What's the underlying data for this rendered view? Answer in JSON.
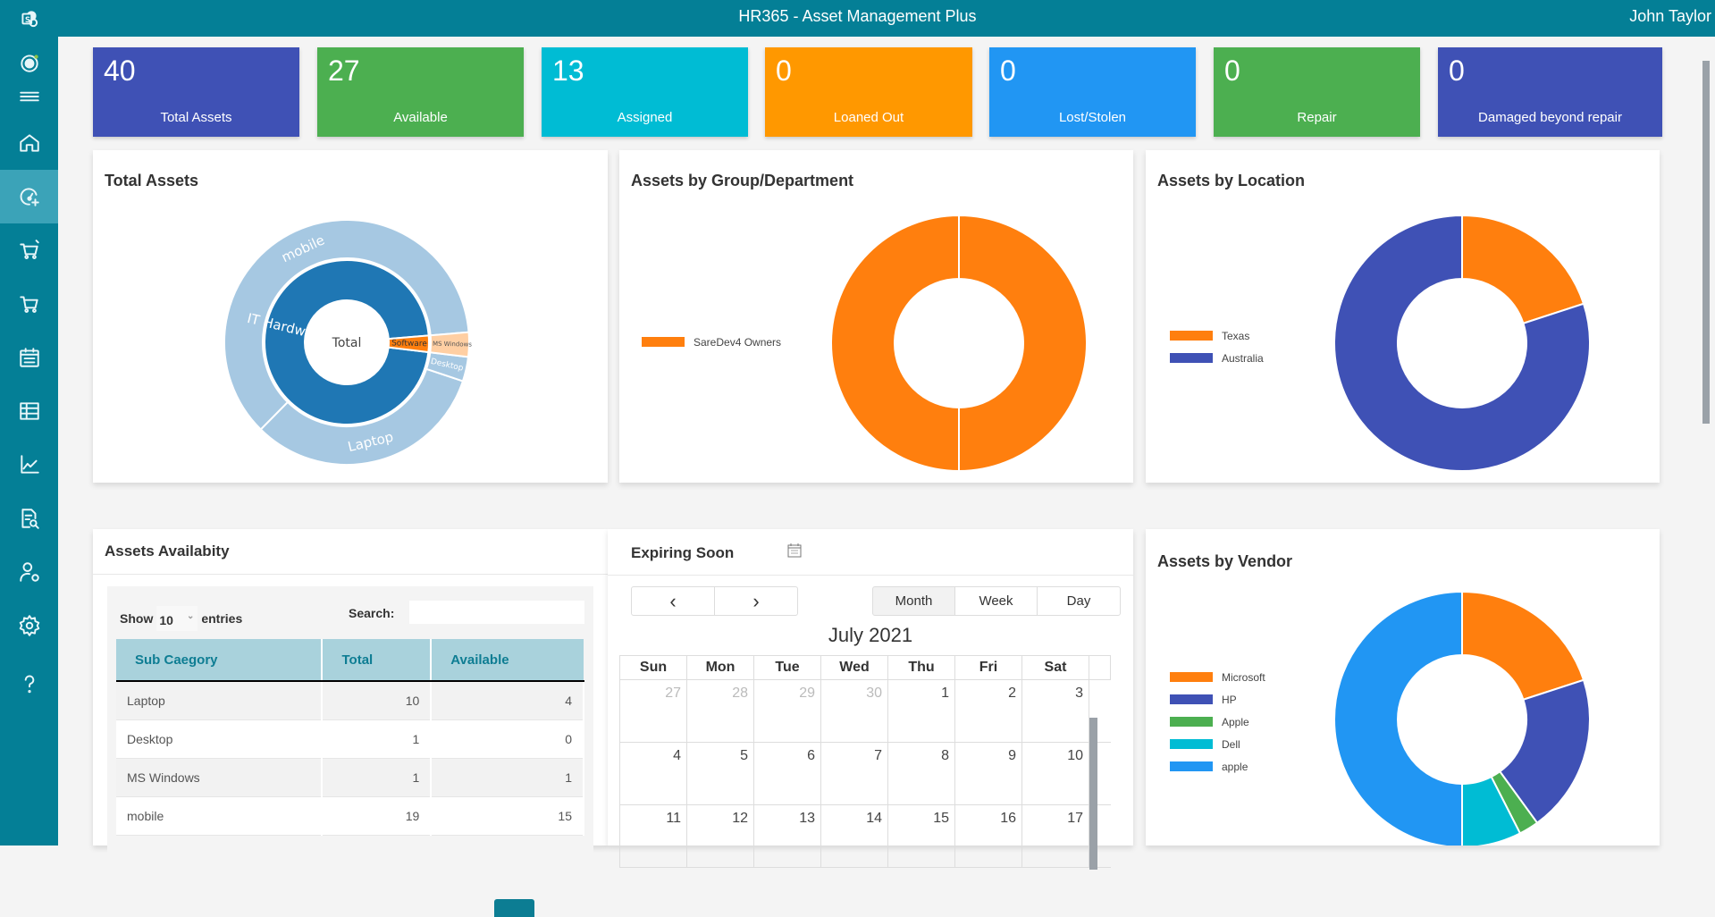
{
  "header": {
    "title": "HR365 - Asset Management Plus",
    "user": "John Taylor"
  },
  "sidebar": {
    "items": [
      {
        "icon": "sharepoint-icon"
      },
      {
        "icon": "team-icon"
      },
      {
        "icon": "hamburger-menu-icon"
      },
      {
        "icon": "home-icon"
      },
      {
        "icon": "dashboard-add-icon",
        "active": true
      },
      {
        "icon": "cart-add-icon"
      },
      {
        "icon": "cart-icon"
      },
      {
        "icon": "calendar-icon"
      },
      {
        "icon": "table-icon"
      },
      {
        "icon": "line-chart-icon"
      },
      {
        "icon": "report-search-icon"
      },
      {
        "icon": "user-settings-icon"
      },
      {
        "icon": "settings-icon"
      },
      {
        "icon": "help-icon"
      }
    ]
  },
  "stats": [
    {
      "value": "40",
      "label": "Total Assets",
      "color": "#3f51b5"
    },
    {
      "value": "27",
      "label": "Available",
      "color": "#4caf50"
    },
    {
      "value": "13",
      "label": "Assigned",
      "color": "#00bcd4"
    },
    {
      "value": "0",
      "label": "Loaned Out",
      "color": "#ff9800"
    },
    {
      "value": "0",
      "label": "Lost/Stolen",
      "color": "#2196f3"
    },
    {
      "value": "0",
      "label": "Repair",
      "color": "#4caf50"
    },
    {
      "value": "0",
      "label": "Damaged beyond repair",
      "color": "#3f51b5"
    }
  ],
  "chart_data": [
    {
      "type": "sunburst",
      "title": "Total Assets",
      "center_label": "Total",
      "inner": [
        {
          "name": "IT Hardware",
          "value": 30,
          "color": "#1f77b4"
        },
        {
          "name": "Software",
          "value": 1,
          "color": "#ff7f0e"
        }
      ],
      "outer": [
        {
          "name": "mobile",
          "parent": "IT Hardware",
          "value": 19,
          "color": "#a6c8e2"
        },
        {
          "name": "Laptop",
          "parent": "IT Hardware",
          "value": 10,
          "color": "#a6c8e2"
        },
        {
          "name": "Desktop",
          "parent": "IT Hardware",
          "value": 1,
          "color": "#a6c8e2"
        },
        {
          "name": "MS Windows",
          "parent": "Software",
          "value": 1,
          "color": "#ffcfa3"
        }
      ]
    },
    {
      "type": "pie",
      "title": "Assets by Group/Department",
      "legend": "left",
      "slices": [
        {
          "name": "SareDev4 Owners",
          "value": 40,
          "color": "#ff7f0e"
        }
      ]
    },
    {
      "type": "pie",
      "title": "Assets by Location",
      "legend": "left",
      "slices": [
        {
          "name": "Texas",
          "value": 8,
          "color": "#ff7f0e"
        },
        {
          "name": "Australia",
          "value": 32,
          "color": "#3f51b5"
        }
      ]
    },
    {
      "type": "pie",
      "title": "Assets by Vendor",
      "legend": "left",
      "slices": [
        {
          "name": "Microsoft",
          "value": 8,
          "color": "#ff7f0e"
        },
        {
          "name": "HP",
          "value": 8,
          "color": "#3f51b5"
        },
        {
          "name": "Apple",
          "value": 1,
          "color": "#4caf50"
        },
        {
          "name": "Dell",
          "value": 3,
          "color": "#00bcd4"
        },
        {
          "name": "apple",
          "value": 20,
          "color": "#2196f3"
        }
      ]
    }
  ],
  "availability": {
    "title": "Assets Availabity",
    "show_label": "Show",
    "entries_value": "10",
    "entries_label": "entries",
    "search_label": "Search:",
    "search_value": "",
    "columns": [
      "Sub Caegory",
      "Total",
      "Available"
    ],
    "rows": [
      [
        "Laptop",
        "10",
        "4"
      ],
      [
        "Desktop",
        "1",
        "0"
      ],
      [
        "MS Windows",
        "1",
        "1"
      ],
      [
        "mobile",
        "19",
        "15"
      ]
    ]
  },
  "calendar": {
    "title": "Expiring Soon",
    "prev": "‹",
    "next": "›",
    "views": [
      "Month",
      "Week",
      "Day"
    ],
    "active_view": "Month",
    "month_title": "July 2021",
    "weekdays": [
      "Sun",
      "Mon",
      "Tue",
      "Wed",
      "Thu",
      "Fri",
      "Sat"
    ],
    "weeks": [
      [
        {
          "d": "27",
          "m": true
        },
        {
          "d": "28",
          "m": true
        },
        {
          "d": "29",
          "m": true
        },
        {
          "d": "30",
          "m": true
        },
        {
          "d": "1"
        },
        {
          "d": "2"
        },
        {
          "d": "3"
        }
      ],
      [
        {
          "d": "4"
        },
        {
          "d": "5"
        },
        {
          "d": "6"
        },
        {
          "d": "7"
        },
        {
          "d": "8"
        },
        {
          "d": "9"
        },
        {
          "d": "10"
        }
      ],
      [
        {
          "d": "11"
        },
        {
          "d": "12"
        },
        {
          "d": "13"
        },
        {
          "d": "14"
        },
        {
          "d": "15"
        },
        {
          "d": "16"
        },
        {
          "d": "17"
        }
      ]
    ]
  }
}
